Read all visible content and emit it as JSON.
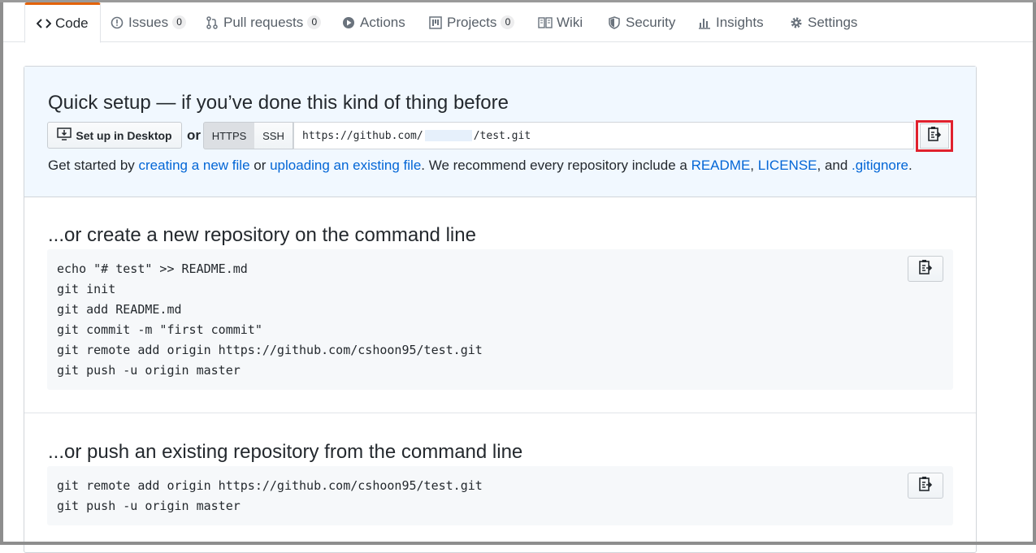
{
  "tabs": [
    {
      "label": "Code",
      "icon": "code-icon",
      "selected": true
    },
    {
      "label": "Issues",
      "icon": "issue-icon",
      "count": "0"
    },
    {
      "label": "Pull requests",
      "icon": "pull-request-icon",
      "count": "0"
    },
    {
      "label": "Actions",
      "icon": "play-icon"
    },
    {
      "label": "Projects",
      "icon": "project-icon",
      "count": "0"
    },
    {
      "label": "Wiki",
      "icon": "book-icon"
    },
    {
      "label": "Security",
      "icon": "shield-icon"
    },
    {
      "label": "Insights",
      "icon": "graph-icon"
    },
    {
      "label": "Settings",
      "icon": "gear-icon"
    }
  ],
  "quick_setup": {
    "title": "Quick setup — if you’ve done this kind of thing before",
    "desktop_button": "Set up in Desktop",
    "or": "or",
    "https_label": "HTTPS",
    "ssh_label": "SSH",
    "url_prefix": "https://github.com/",
    "url_suffix": "/test.git",
    "highlight_color": "#e0212e",
    "getstarted": {
      "t1": "Get started by ",
      "link1": "creating a new file",
      "t2": " or ",
      "link2": "uploading an existing file",
      "t3": ". We recommend every repository include a ",
      "link3": "README",
      "t4": ", ",
      "link4": "LICENSE",
      "t5": ", and ",
      "link5": ".gitignore",
      "t6": "."
    }
  },
  "create_section": {
    "title": "...or create a new repository on the command line",
    "lines": [
      "echo \"# test\" >> README.md",
      "git init",
      "git add README.md",
      "git commit -m \"first commit\"",
      "git remote add origin https://github.com/cshoon95/test.git",
      "git push -u origin master"
    ]
  },
  "push_section": {
    "title": "...or push an existing repository from the command line",
    "lines": [
      "git remote add origin https://github.com/cshoon95/test.git",
      "git push -u origin master"
    ]
  }
}
